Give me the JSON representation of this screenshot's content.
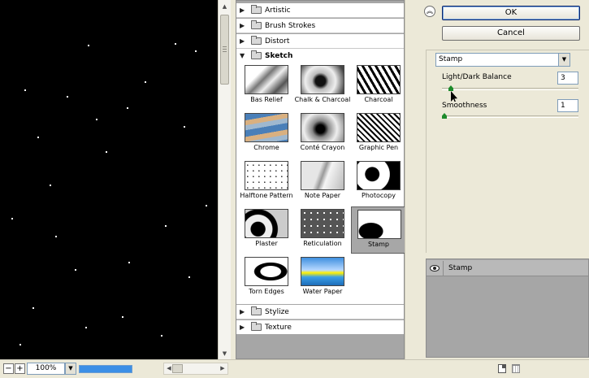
{
  "preview": {
    "zoom": "100%"
  },
  "gallery": {
    "categories_top": [
      "Artistic",
      "Brush Strokes",
      "Distort"
    ],
    "open_category": "Sketch",
    "categories_bottom": [
      "Stylize",
      "Texture"
    ],
    "filters": [
      {
        "label": "Bas Relief"
      },
      {
        "label": "Chalk & Charcoal"
      },
      {
        "label": "Charcoal"
      },
      {
        "label": "Chrome"
      },
      {
        "label": "Conté Crayon"
      },
      {
        "label": "Graphic Pen"
      },
      {
        "label": "Halftone Pattern"
      },
      {
        "label": "Note Paper"
      },
      {
        "label": "Photocopy"
      },
      {
        "label": "Plaster"
      },
      {
        "label": "Reticulation"
      },
      {
        "label": "Stamp"
      },
      {
        "label": "Torn Edges"
      },
      {
        "label": "Water Paper"
      }
    ],
    "selected_filter": "Stamp"
  },
  "actions": {
    "ok_label": "OK",
    "cancel_label": "Cancel"
  },
  "settings": {
    "filter_select": "Stamp",
    "params": [
      {
        "label": "Light/Dark Balance",
        "value": "3",
        "fraction": 0.05
      },
      {
        "label": "Smoothness",
        "value": "1",
        "fraction": 0.0
      }
    ]
  },
  "effects": {
    "layers": [
      "Stamp"
    ]
  }
}
